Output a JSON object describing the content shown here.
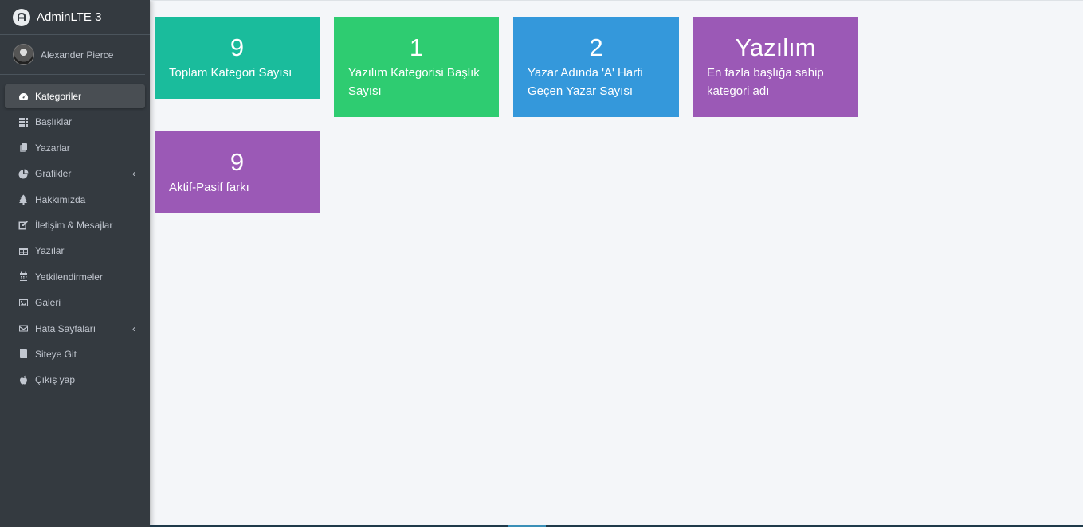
{
  "brand": {
    "title": "AdminLTE 3"
  },
  "user": {
    "name": "Alexander Pierce"
  },
  "nav": [
    {
      "label": "Kategoriler",
      "icon": "tachometer-icon",
      "active": true
    },
    {
      "label": "Başlıklar",
      "icon": "grid-icon"
    },
    {
      "label": "Yazarlar",
      "icon": "copy-icon"
    },
    {
      "label": "Grafikler",
      "icon": "pie-chart-icon",
      "chevron": true
    },
    {
      "label": "Hakkımızda",
      "icon": "tree-icon"
    },
    {
      "label": "İletişim & Mesajlar",
      "icon": "edit-icon"
    },
    {
      "label": "Yazılar",
      "icon": "table-icon"
    },
    {
      "label": "Yetkilendirmeler",
      "icon": "calendar-icon"
    },
    {
      "label": "Galeri",
      "icon": "image-icon"
    },
    {
      "label": "Hata Sayfaları",
      "icon": "envelope-icon",
      "chevron": true
    },
    {
      "label": "Siteye Git",
      "icon": "book-icon"
    },
    {
      "label": "Çıkış yap",
      "icon": "apple-icon"
    }
  ],
  "chevron_glyph": "‹",
  "stats": [
    {
      "value": "9",
      "label": "Toplam Kategori Sayısı",
      "color": "#1abc9c"
    },
    {
      "value": "1",
      "label": "Yazılım Kategorisi Başlık Sayısı",
      "color": "#2ecc71"
    },
    {
      "value": "2",
      "label": "Yazar Adında 'A' Harfi Geçen Yazar Sayısı",
      "color": "#3498db"
    },
    {
      "value": "Yazılım",
      "label": "En fazla başlığa sahip kategori adı",
      "color": "#9b59b6"
    },
    {
      "value": "9",
      "label": "Aktif-Pasif farkı",
      "color": "#9b59b6"
    }
  ]
}
